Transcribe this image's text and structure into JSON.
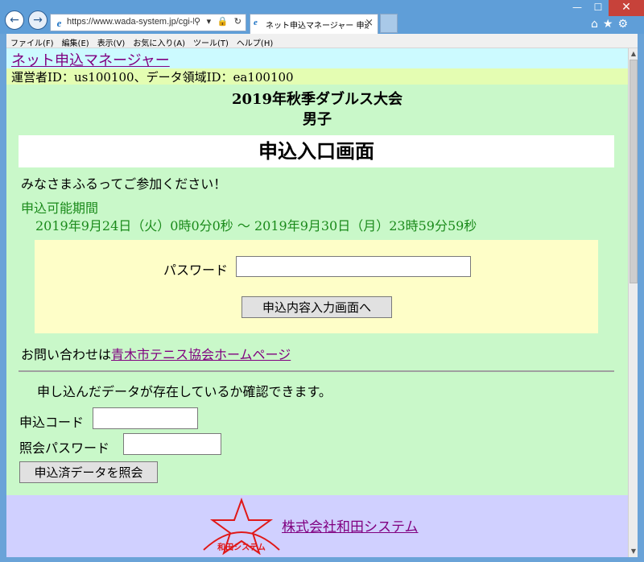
{
  "browser": {
    "url": "https://www.wada-system.jp/cgi-bir",
    "tab_title": "ネット申込マネージャー 申込...",
    "back_glyph": "←",
    "forward_glyph": "→",
    "tab_close_glyph": "×",
    "address_icons": "⚲ ▾ 🔒 ↻",
    "window_buttons": {
      "minimize": "—",
      "maximize": "☐",
      "close": "✕"
    },
    "tool_icons": "⌂★⚙"
  },
  "menu": [
    "ファイル(F)",
    "編集(E)",
    "表示(V)",
    "お気に入り(A)",
    "ツール(T)",
    "ヘルプ(H)"
  ],
  "site": {
    "title": "ネット申込マネージャー",
    "operator": "運営者ID：us100100、データ領域ID：ea100100"
  },
  "event": {
    "name": "2019年秋季ダブルス大会",
    "category": "男子"
  },
  "page": {
    "heading": "申込入口画面",
    "welcome": "みなさまふるってご参加ください！",
    "period_label": "申込可能期間",
    "period_range": "2019年9月24日（火）0時0分0秒 〜 2019年9月30日（月）23時59分59秒"
  },
  "login": {
    "password_label": "パスワード",
    "password_value": "",
    "enter_button": "申込内容入力画面へ"
  },
  "contact": {
    "prefix": "お問い合わせは",
    "link": "青木市テニス協会ホームページ"
  },
  "inquiry": {
    "note": "申し込んだデータが存在しているか確認できます。",
    "code_label": "申込コード",
    "code_value": "",
    "password_label": "照会パスワード",
    "password_value": "",
    "button": "申込済データを照会"
  },
  "footer": {
    "logo_text": "和田システム",
    "company_name": "株式会社和田システム"
  },
  "colors": {
    "page_bg": "#c9f8c9",
    "header_bg": "#ccfaff",
    "operator_bg": "#e4fdb2",
    "login_box_bg": "#fefec8",
    "footer_bg": "#d0d0ff",
    "link": "#800080",
    "period": "#1a8a1a",
    "logo_red": "#e01818"
  }
}
